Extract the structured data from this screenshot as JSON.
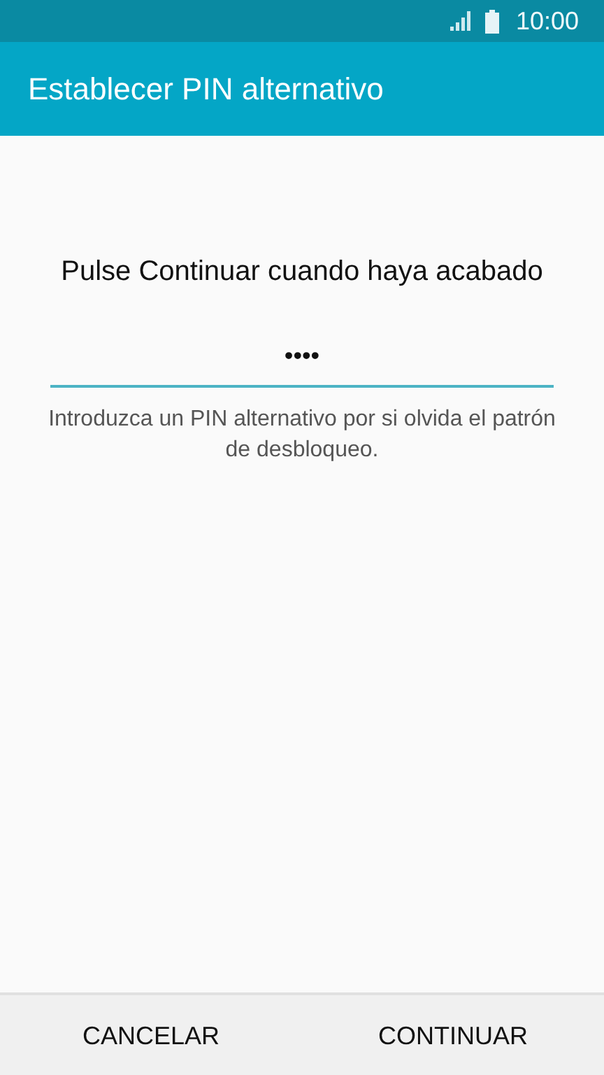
{
  "status_bar": {
    "time": "10:00"
  },
  "app_bar": {
    "title": "Establecer PIN alternativo"
  },
  "prompt": "Pulse Continuar cuando haya acabado",
  "pin_field": {
    "value": "••••"
  },
  "hint": "Introduzca un PIN alternativo por si olvida el patrón de desbloqueo.",
  "buttons": [
    {
      "label": "CANCELAR"
    },
    {
      "label": "CONTINUAR"
    }
  ]
}
